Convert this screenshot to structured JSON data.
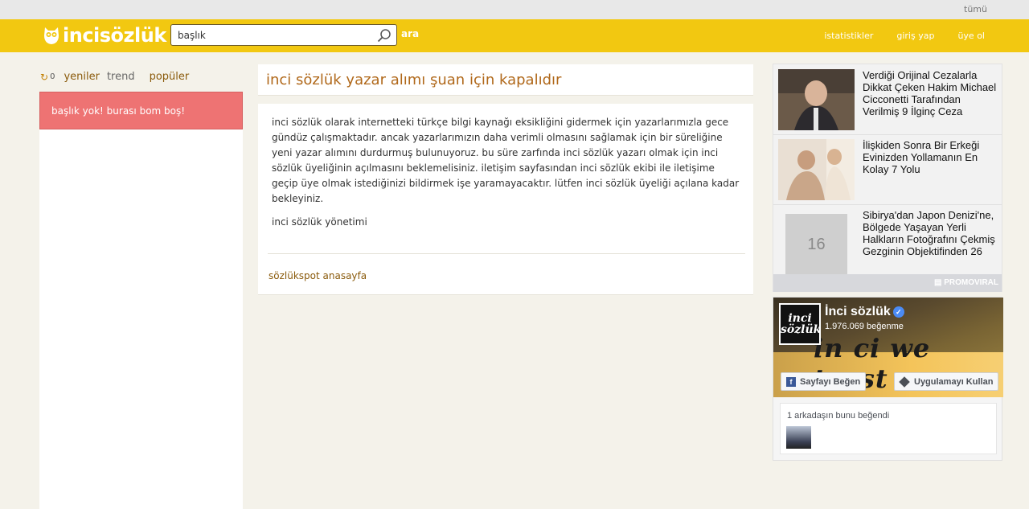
{
  "topbar": {
    "all_label": "tümü"
  },
  "header": {
    "logo_text": "incisözlük",
    "search": {
      "value": "başlık"
    },
    "search_button": "ara",
    "nav": [
      "istatistikler",
      "giriş yap",
      "üye ol"
    ]
  },
  "left": {
    "count": "0",
    "tabs": [
      "yeniler",
      "trend",
      "popüler"
    ],
    "empty_message": "başlık yok! burası bom boş!"
  },
  "main": {
    "title": "inci sözlük yazar alımı şuan için kapalıdır",
    "paragraph1": "inci sözlük olarak internetteki türkçe bilgi kaynağı eksikliğini gidermek için yazarlarımızla gece gündüz çalışmaktadır. ancak yazarlarımızın daha verimli olmasını sağlamak için bir süreliğine yeni yazar alımını durdurmuş bulunuyoruz. bu süre zarfında inci sözlük yazarı olmak için inci sözlük üyeliğinin açılmasını beklemelisiniz. iletişim sayfasından inci sözlük ekibi ile iletişime geçip üye olmak istediğinizi bildirmek işe yaramayacaktır. lütfen inci sözlük üyeliği açılana kadar bekleyiniz.",
    "paragraph2": "inci sözlük yönetimi",
    "home_link": "sözlükspot anasayfa"
  },
  "ads": {
    "items": [
      {
        "text": "Verdiği Orijinal Cezalarla Dikkat Çeken Hakim Michael Cicconetti Tarafından Verilmiş 9 İlginç Ceza"
      },
      {
        "text": "İlişkiden Sonra Bir Erkeği Evinizden Yollamanın En Kolay 7 Yolu"
      },
      {
        "text": "Sibirya'dan Japon Denizi'ne, Bölgede Yaşayan Yerli Halkların Fotoğrafını Çekmiş Gezginin Objektifinden 26",
        "thumb_label": "16"
      }
    ],
    "brand": "PROMOVIRAL"
  },
  "facebook": {
    "page_name": "İnci sözlük",
    "logo_text": "inci sözlük",
    "likes": "1.976.069 beğenme",
    "cover_text": "in ci we trust",
    "like_button": "Sayfayı Beğen",
    "app_button": "Uygulamayı Kullan",
    "friends_text": "1 arkadaşın bunu beğendi"
  }
}
